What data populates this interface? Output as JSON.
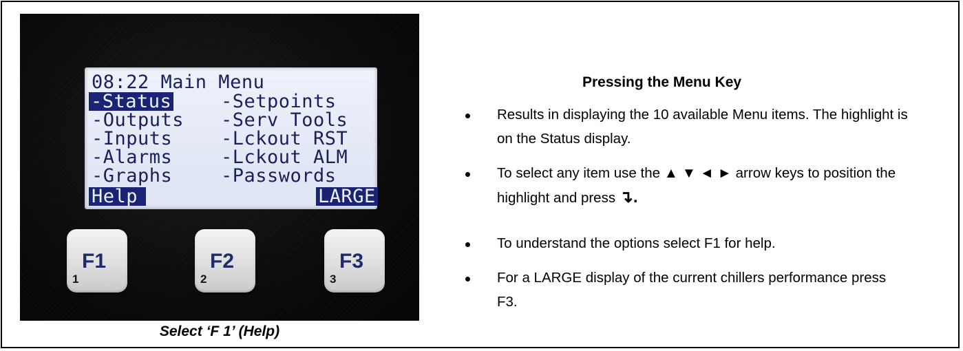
{
  "lcd": {
    "title_line": "08:22 Main Menu",
    "menu_left": [
      "-Status",
      "-Outputs",
      "-Inputs",
      "-Alarms",
      "-Graphs"
    ],
    "menu_right": [
      "-Setpoints",
      "-Serv Tools",
      "-Lckout RST",
      "-Lckout ALM",
      "-Passwords"
    ],
    "softkey_left": "Help",
    "softkey_right": "LARGE",
    "highlighted_item": "-Status"
  },
  "function_keys": [
    {
      "label": "F1",
      "number": "1"
    },
    {
      "label": "F2",
      "number": "2"
    },
    {
      "label": "F3",
      "number": "3"
    }
  ],
  "caption": "Select ‘F 1’ (Help)",
  "instructions": {
    "heading": "Pressing the Menu Key",
    "bullets": [
      "Results in displaying the 10 available Menu items. The highlight is on the Status display.",
      "To select any item use the ▲ ▼ ◄ ► arrow keys to position the highlight and press",
      "To understand the options select F1 for help.",
      "For a LARGE display of the current chillers performance press F3."
    ],
    "enter_symbol": "↴."
  },
  "colors": {
    "lcd_background": "#e4e9f6",
    "lcd_text": "#17205a",
    "lcd_highlight": "#1a2275",
    "key_label": "#1e2a6e"
  }
}
